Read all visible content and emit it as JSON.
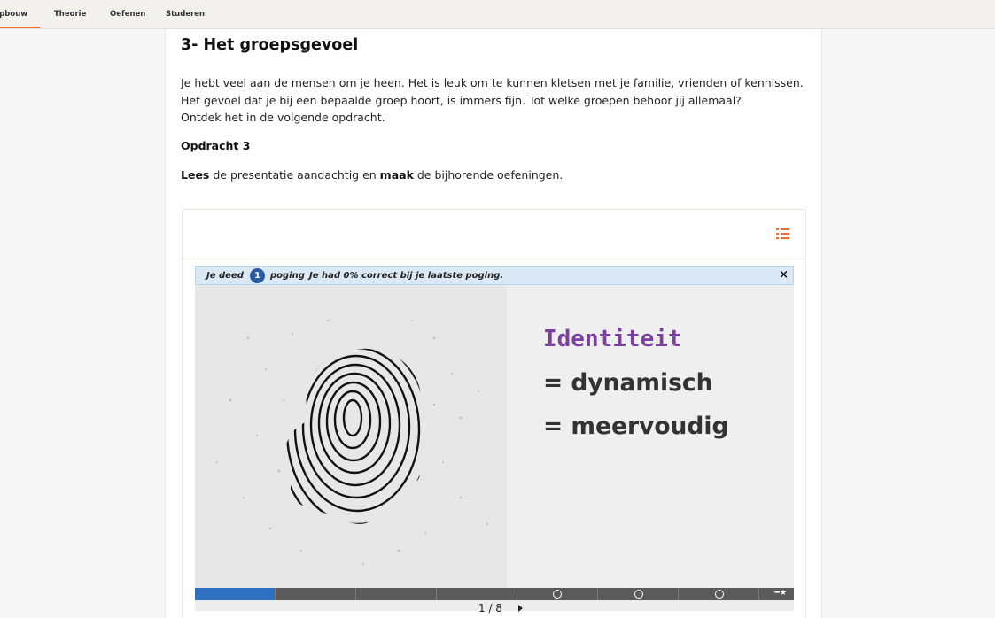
{
  "nav": {
    "tabs": [
      {
        "label": "Opbouw",
        "active": true
      },
      {
        "label": "Theorie",
        "active": false
      },
      {
        "label": "Oefenen",
        "active": false
      },
      {
        "label": "Studeren",
        "active": false
      }
    ],
    "accent_color": "#e8703a"
  },
  "content": {
    "title": "3- Het groepsgevoel",
    "intro_lines": [
      "Je hebt veel aan de mensen om je heen. Het is leuk om te kunnen kletsen met je familie, vrienden of kennissen.",
      "Het gevoel dat je bij een bepaalde groep hoort, is immers fijn. Tot welke groepen behoor jij allemaal?",
      "Ontdek het in de volgende opdracht."
    ],
    "task_heading": "Opdracht 3",
    "task": {
      "verb1": "Lees",
      "middle": " de presentatie aandachtig en ",
      "verb2": "maak",
      "end": " de bijhorende oefeningen."
    }
  },
  "presentation": {
    "menu_icon": "list-icon",
    "attempt": {
      "prefix": "Je deed",
      "count": "1",
      "suffix": "poging",
      "result": "Je had 0% correct bij je laatste poging.",
      "close_icon": "close-icon",
      "close_label": "×"
    },
    "slide": {
      "image": "fingerprint-head",
      "title": "Identiteit",
      "lines": [
        "= dynamisch",
        "= meervoudig"
      ],
      "title_color": "#7a3fa0"
    },
    "progress": {
      "segments": 8,
      "completed": 1,
      "end_icon": "star-icon",
      "end_label": "━★"
    },
    "pager": {
      "text": "1 / 8",
      "current": 1,
      "total": 8
    }
  }
}
